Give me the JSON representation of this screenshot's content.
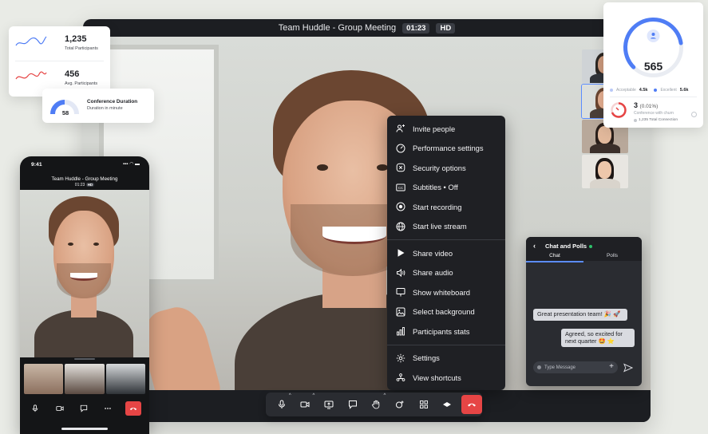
{
  "meeting": {
    "title": "Team Huddle - Group Meeting",
    "timer": "01:23",
    "quality_badge": "HD"
  },
  "menu": {
    "items": [
      {
        "label": "Invite people",
        "icon": "invite-people-icon"
      },
      {
        "label": "Performance settings",
        "icon": "gauge-icon"
      },
      {
        "label": "Security options",
        "icon": "shield-x-icon"
      },
      {
        "label": "Subtitles • Off",
        "icon": "cc-icon"
      },
      {
        "label": "Start recording",
        "icon": "record-icon"
      },
      {
        "label": "Start live stream",
        "icon": "globe-icon"
      },
      {
        "label": "Share video",
        "icon": "play-icon"
      },
      {
        "label": "Share audio",
        "icon": "speaker-icon"
      },
      {
        "label": "Show whiteboard",
        "icon": "whiteboard-icon"
      },
      {
        "label": "Select background",
        "icon": "image-icon"
      },
      {
        "label": "Participants stats",
        "icon": "bar-chart-icon"
      },
      {
        "label": "Settings",
        "icon": "gear-icon"
      },
      {
        "label": "View shortcuts",
        "icon": "shortcuts-icon"
      }
    ]
  },
  "chat": {
    "title": "Chat and Polls",
    "tabs": [
      "Chat",
      "Polls"
    ],
    "messages": [
      {
        "text": "Great presentation team! 🎉 🚀"
      },
      {
        "text": "Agreed, so excited for next quarter 🤩 ⭐"
      }
    ],
    "input_placeholder": "Type Message",
    "online_color": "#2ec26a"
  },
  "stats": {
    "total_participants": {
      "value": "1,235",
      "label": "Total Participants"
    },
    "avg_participants": {
      "value": "456",
      "label": "Avg. Participants"
    },
    "duration": {
      "value": "58",
      "title": "Conference Duration",
      "subtitle": "Duration in minute",
      "fill_fraction": 0.5
    }
  },
  "ring_card": {
    "value": "565",
    "fill_fraction": 0.6,
    "acceptable_label": "Acceptable",
    "acceptable_value": "4.5k",
    "excellent_label": "Excellent",
    "excellent_value": "5.6k",
    "churn_value": "3",
    "churn_pct": "(0.01%)",
    "churn_label": "Conference with churn",
    "total_connection": "1,235 Total Connection",
    "colors": {
      "ring": "#4f7df5",
      "churn": "#e64545"
    }
  },
  "phone": {
    "time": "9:41",
    "title": "Team Huddle - Group Meeting",
    "timer": "01:23",
    "quality_badge": "HD"
  },
  "colors": {
    "accent": "#4f7df5",
    "end_call": "#e64545",
    "spark_blue": "#4f7df5",
    "spark_red": "#e64545"
  }
}
